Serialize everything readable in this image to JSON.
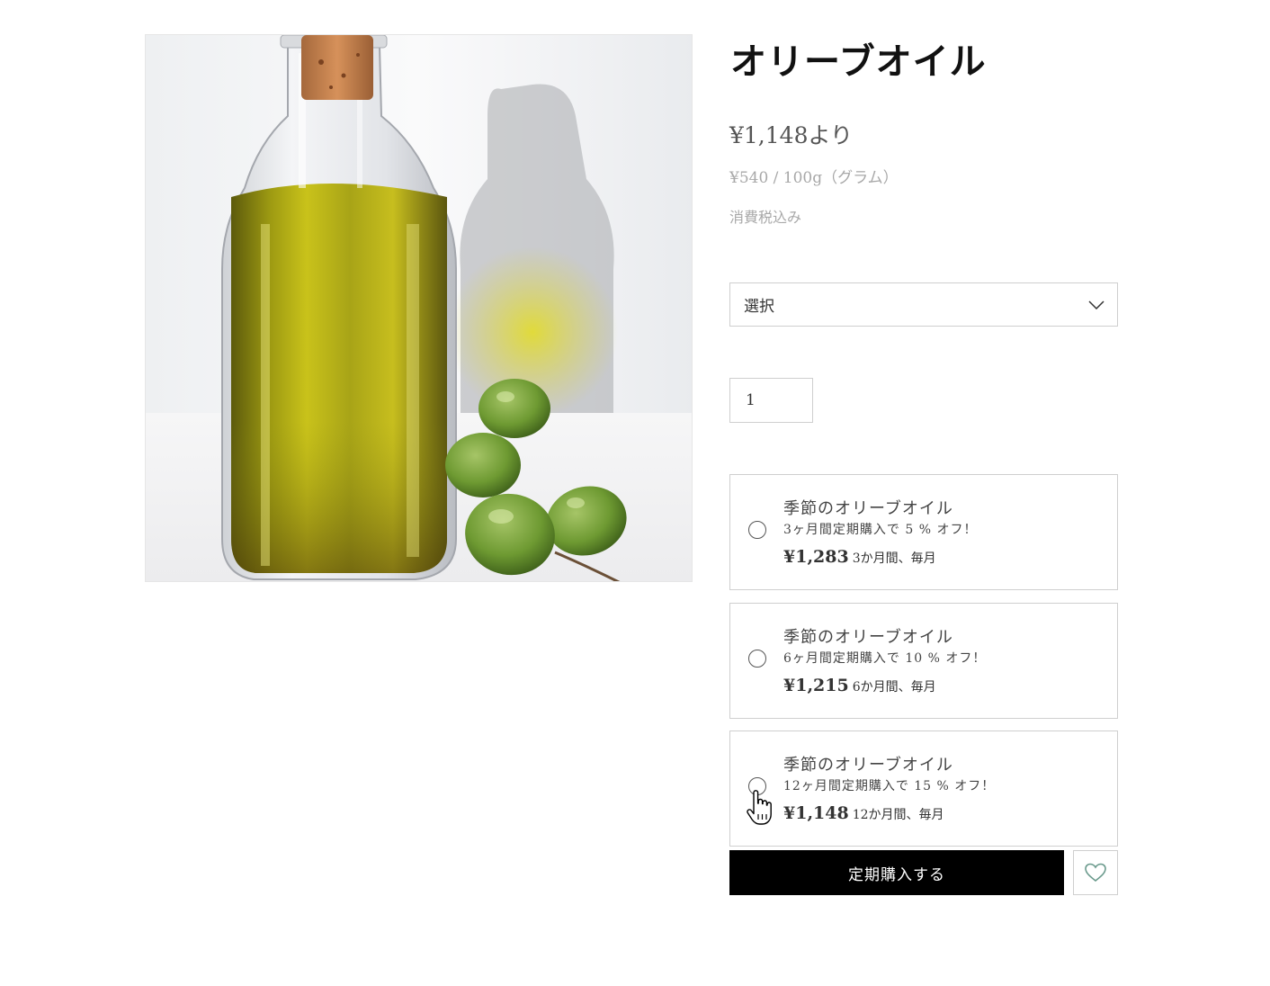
{
  "product": {
    "title": "オリーブオイル",
    "price": "¥1,148より",
    "unit_price": "¥540 / 100g（グラム）",
    "tax_note": "消費税込み",
    "image_icon": "olive-oil-bottle-photo"
  },
  "options": {
    "select_value": "選択",
    "select_icon": "chevron-down-icon"
  },
  "quantity": {
    "value": "1"
  },
  "plans": [
    {
      "name": "季節のオリーブオイル",
      "description": "3ヶ月間定期購入で 5 % オフ！",
      "amount": "¥1,283",
      "frequency": "3か月間、毎月"
    },
    {
      "name": "季節のオリーブオイル",
      "description": "6ヶ月間定期購入で 10 % オフ！",
      "amount": "¥1,215",
      "frequency": "6か月間、毎月"
    },
    {
      "name": "季節のオリーブオイル",
      "description": "12ヶ月間定期購入で 15 % オフ！",
      "amount": "¥1,148",
      "frequency": "12か月間、毎月"
    }
  ],
  "actions": {
    "subscribe_label": "定期購入する",
    "wishlist_icon": "heart-icon"
  },
  "colors": {
    "button_bg": "#000000",
    "button_text": "#ffffff",
    "heart": "#6a9a8c",
    "border": "#cfcfcf"
  }
}
